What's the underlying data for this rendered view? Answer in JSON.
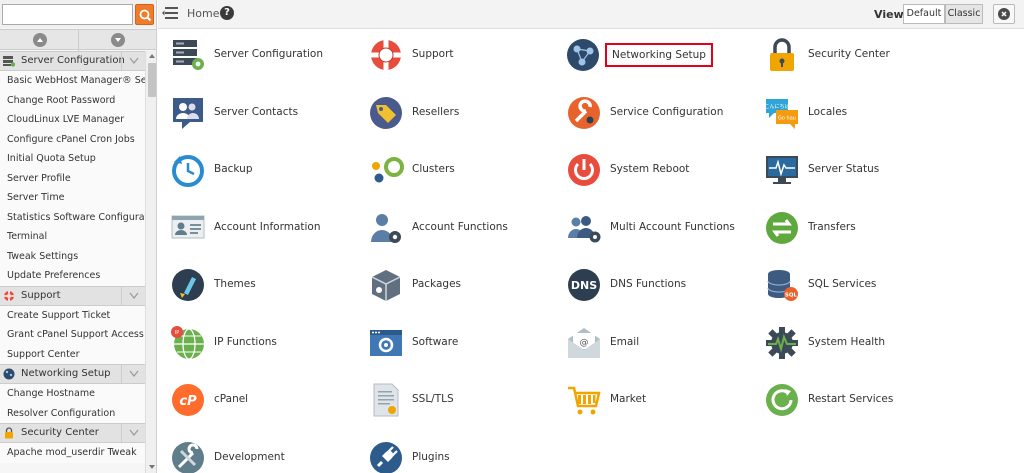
{
  "search": {
    "value": "",
    "placeholder": ""
  },
  "sidebar": {
    "categories": [
      {
        "label": "Server Configuration",
        "icon": "server-icon",
        "items": [
          "Basic WebHost Manager® Setup",
          "Change Root Password",
          "CloudLinux LVE Manager",
          "Configure cPanel Cron Jobs",
          "Initial Quota Setup",
          "Server Profile",
          "Server Time",
          "Statistics Software Configuration",
          "Terminal",
          "Tweak Settings",
          "Update Preferences"
        ]
      },
      {
        "label": "Support",
        "icon": "lifebuoy-icon",
        "items": [
          "Create Support Ticket",
          "Grant cPanel Support Access",
          "Support Center"
        ]
      },
      {
        "label": "Networking Setup",
        "icon": "network-icon",
        "items": [
          "Change Hostname",
          "Resolver Configuration"
        ]
      },
      {
        "label": "Security Center",
        "icon": "lock-icon",
        "items": [
          "Apache mod_userdir Tweak"
        ]
      }
    ]
  },
  "topbar": {
    "breadcrumb": "Home",
    "view_label": "View:",
    "view_default": "Default",
    "view_classic": "Classic"
  },
  "grid": {
    "rows": [
      [
        "Server Configuration",
        "Support",
        "Networking Setup",
        "Security Center"
      ],
      [
        "Server Contacts",
        "Resellers",
        "Service Configuration",
        "Locales"
      ],
      [
        "Backup",
        "Clusters",
        "System Reboot",
        "Server Status"
      ],
      [
        "Account Information",
        "Account Functions",
        "Multi Account Functions",
        "Transfers"
      ],
      [
        "Themes",
        "Packages",
        "DNS Functions",
        "SQL Services"
      ],
      [
        "IP Functions",
        "Software",
        "Email",
        "System Health"
      ],
      [
        "cPanel",
        "SSL/TLS",
        "Market",
        "Restart Services"
      ],
      [
        "Development",
        "Plugins"
      ]
    ],
    "highlighted": "Networking Setup",
    "icon_text": {
      "dns": "DNS",
      "locales_top": "こんにちは",
      "locales_bottom": "Go hau",
      "sql": "SQL"
    }
  },
  "colors": {
    "accent_orange": "#f07b2b",
    "highlight_red": "#e3001b",
    "icon_blue": "#1e6fa8",
    "icon_green": "#6ab04c",
    "icon_dark": "#2d3e50"
  }
}
